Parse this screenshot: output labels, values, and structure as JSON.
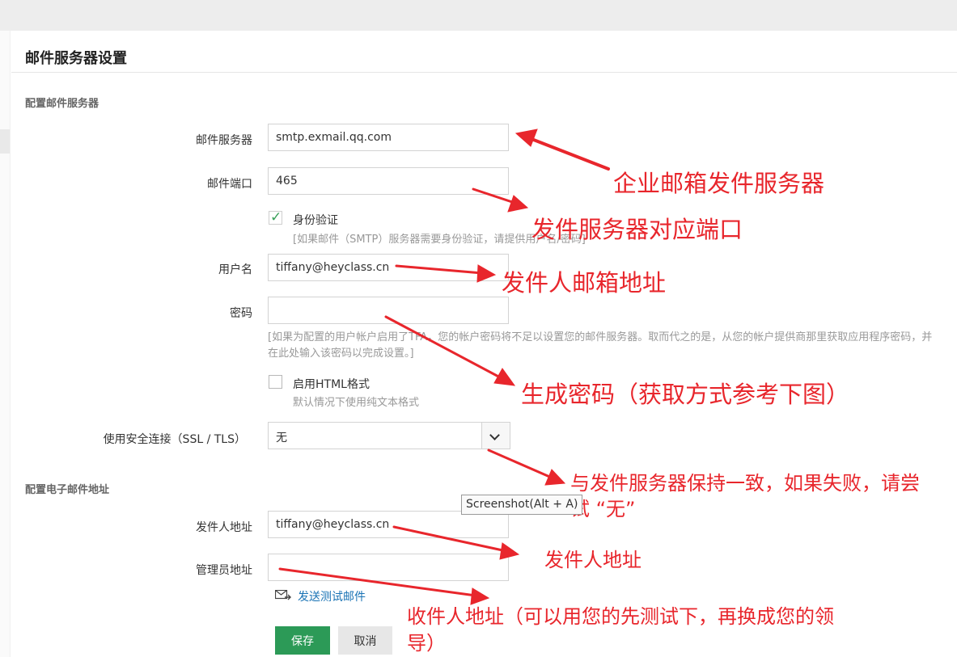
{
  "page": {
    "title": "邮件服务器设置",
    "section_server": "配置邮件服务器",
    "section_address": "配置电子邮件地址"
  },
  "form": {
    "server_label": "邮件服务器",
    "server_value": "smtp.exmail.qq.com",
    "port_label": "邮件端口",
    "port_value": "465",
    "auth_label": "身份验证",
    "auth_checked": true,
    "auth_hint": "[如果邮件（SMTP）服务器需要身份验证，请提供用户名/密码]",
    "username_label": "用户名",
    "username_value": "tiffany@heyclass.cn",
    "password_label": "密码",
    "password_value": "",
    "password_hint": "[如果为配置的用户帐户启用了TFA，您的帐户密码将不足以设置您的邮件服务器。取而代之的是，从您的帐户提供商那里获取应用程序密码，并在此处输入该密码以完成设置。]",
    "html_label": "启用HTML格式",
    "html_checked": false,
    "html_hint": "默认情况下使用纯文本格式",
    "security_label": "使用安全连接（SSL / TLS）",
    "security_value": "无",
    "sender_label": "发件人地址",
    "sender_value": "tiffany@heyclass.cn",
    "admin_label": "管理员地址",
    "admin_value": "",
    "test_link": "发送测试邮件",
    "save_label": "保存",
    "cancel_label": "取消"
  },
  "tooltip": "Screenshot(Alt + A)",
  "annotations": {
    "server": "企业邮箱发件服务器",
    "port": "发件服务器对应端口",
    "username": "发件人邮箱地址",
    "password": "生成密码（获取方式参考下图）",
    "security_line1": "与发件服务器保持一致，如果失败，请尝",
    "security_line2": "试 “无”",
    "sender": "发件人地址",
    "admin_line1": "收件人地址（可以用您的先测试下，再换成您的领",
    "admin_line2": "导）"
  },
  "colors": {
    "accent_save": "#2c9a57",
    "annotation": "#e8262c",
    "link": "#1a73b5",
    "check": "#3aa05a"
  }
}
